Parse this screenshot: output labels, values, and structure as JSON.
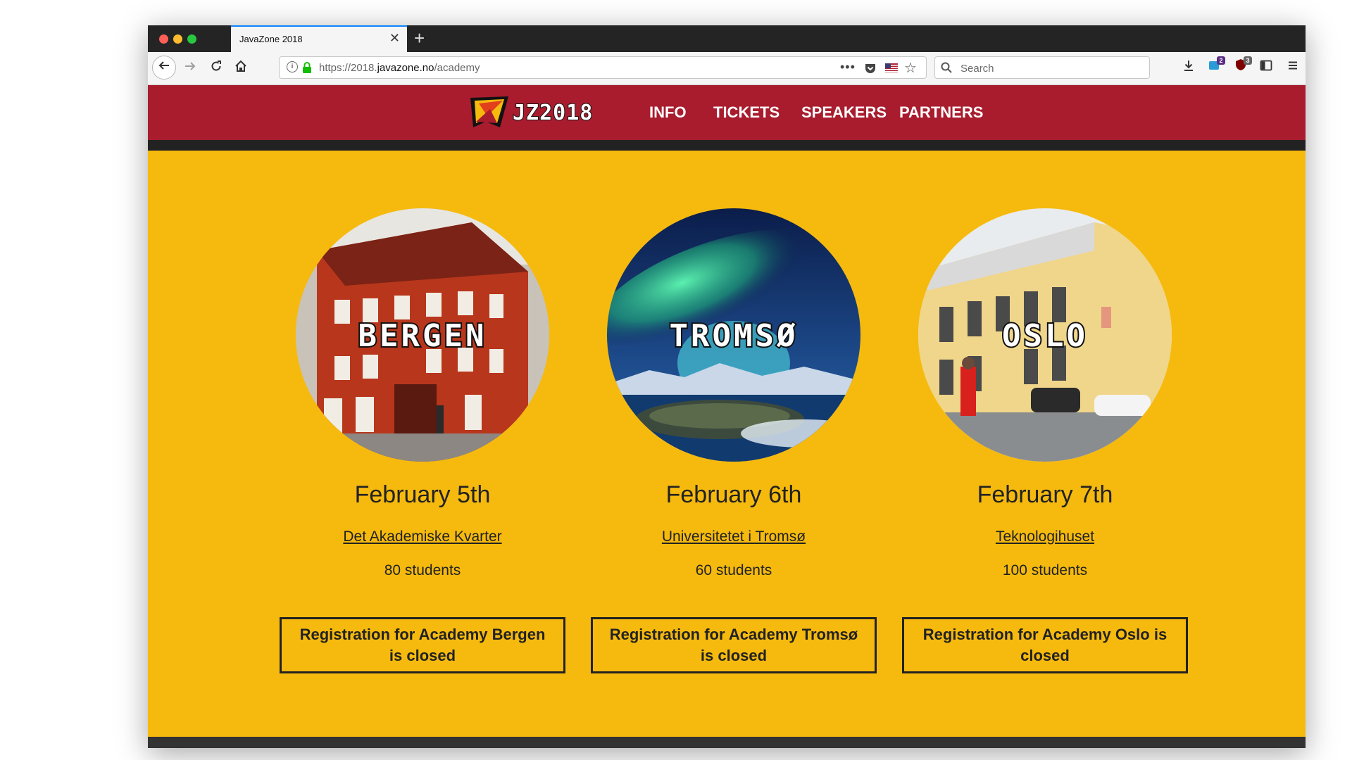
{
  "browser": {
    "tab_title": "JavaZone 2018",
    "tab_close": "✕",
    "new_tab": "+",
    "url_prefix": "https://2018.",
    "url_domain": "javazone.no",
    "url_path": "/academy",
    "url_more": "•••",
    "search_placeholder": "Search",
    "badge_ext1": "2",
    "badge_ext2": "3"
  },
  "site": {
    "logo_text": "JZ2018",
    "nav": [
      "INFO",
      "TICKETS",
      "SPEAKERS",
      "PARTNERS"
    ]
  },
  "academies": [
    {
      "city": "BERGEN",
      "date": "February 5th",
      "venue": "Det Akademiske Kvarter",
      "students": "80 students",
      "registration": "Registration for Academy Bergen is closed"
    },
    {
      "city": "TROMSØ",
      "date": "February 6th",
      "venue": "Universitetet i Tromsø",
      "students": "60 students",
      "registration": "Registration for Academy Tromsø is closed"
    },
    {
      "city": "OSLO",
      "date": "February 7th",
      "venue": "Teknologihuset",
      "students": "100 students",
      "registration": "Registration for Academy Oslo is closed"
    }
  ],
  "colors": {
    "header": "#a81c2e",
    "background": "#f6ba0e",
    "dark": "#222222"
  }
}
